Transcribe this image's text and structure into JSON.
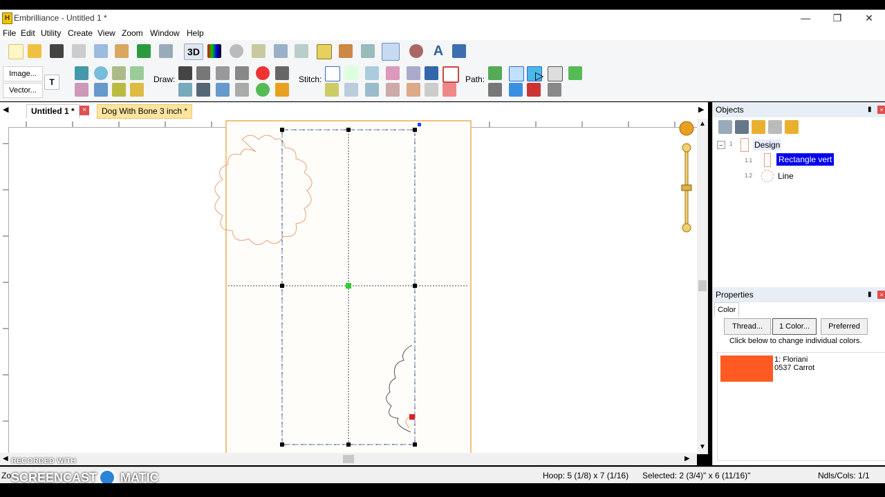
{
  "window": {
    "title": "Embrilliance - Untitled 1 *",
    "app_icon": "app-icon",
    "controls": [
      "minimize",
      "maximize",
      "close"
    ]
  },
  "menu": [
    "File",
    "Edit",
    "Utility",
    "Create",
    "View",
    "Zoom",
    "Window",
    "Help"
  ],
  "toolbar2": {
    "image_btn": "Image...",
    "vector_btn": "Vector...",
    "draw_label": "Draw:",
    "stitch_label": "Stitch:",
    "path_label": "Path:"
  },
  "tabs": [
    {
      "label": "Untitled 1 *"
    },
    {
      "label": "Dog With Bone 3 inch *"
    }
  ],
  "objects_panel": {
    "title": "Objects",
    "tree": [
      {
        "num": "1",
        "label": "Design"
      },
      {
        "num": "1.1",
        "label": "Rectangle vert"
      },
      {
        "num": "1.2",
        "label": "Line"
      }
    ]
  },
  "properties_panel": {
    "title": "Properties",
    "tab": "Color",
    "buttons": [
      "Thread...",
      "1 Color...",
      "Preferred"
    ],
    "hint": "Click below to change individual colors.",
    "color_swatch": "#ff5a22",
    "color_line1": "1: Floriani",
    "color_line2": "0537 Carrot"
  },
  "status": {
    "zoom_prefix": "Zo",
    "hoop": "Hoop: 5 (1/8) x 7 (1/16)",
    "selected": "Selected: 2 (3/4)\" x 6 (11/16)\"",
    "ndls": "Ndls/Cols: 1/1"
  },
  "watermark": {
    "line1": "RECORDED WITH",
    "line2": "SCREENCAST",
    "line3": "MATIC"
  },
  "colors": {
    "selection": "#0000ff",
    "hoop_border": "#f0c27a",
    "stitch_red": "#ff5a22",
    "tab_active": "#fde5a0"
  }
}
